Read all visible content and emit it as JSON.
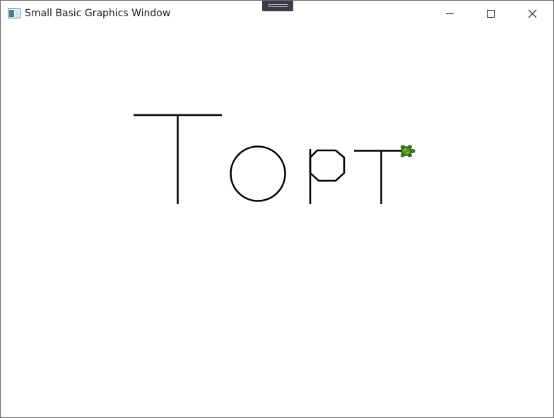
{
  "window": {
    "title": "Small Basic Graphics Window",
    "app_icon": "small-basic-icon"
  },
  "controls": {
    "minimize_icon": "minimize-icon",
    "maximize_icon": "maximize-icon",
    "close_icon": "close-icon"
  },
  "canvas": {
    "background": "#ffffff",
    "stroke_color": "#000000",
    "turtle_color": "#3f8f1f",
    "drawing": [
      {
        "name": "letter-t-large-stroke",
        "label": "T"
      },
      {
        "name": "letter-o-stroke",
        "label": "o"
      },
      {
        "name": "letter-p-stroke",
        "label": "p"
      },
      {
        "name": "letter-t-small-stroke",
        "label": "т"
      }
    ],
    "turtle_icon": "turtle-icon"
  }
}
